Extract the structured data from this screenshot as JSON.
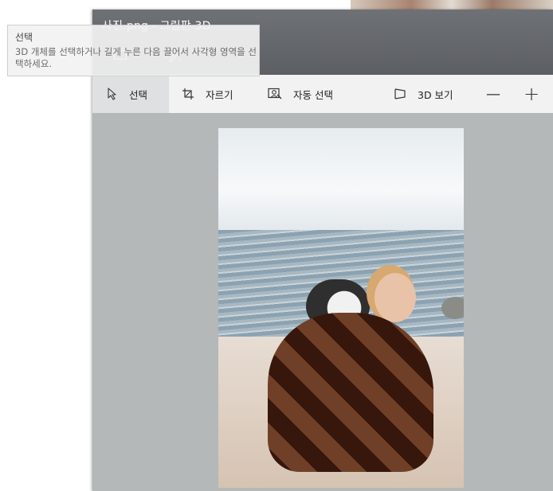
{
  "window": {
    "title": "사진.png - 그림판 3D"
  },
  "toolbar": {
    "select_label": "선택",
    "crop_label": "자르기",
    "magic_select_label": "자동 선택",
    "view3d_label": "3D 보기",
    "zoom_out_symbol": "—",
    "zoom_in_symbol": "+"
  },
  "tooltip": {
    "title": "선택",
    "body": "3D 개체를 선택하거나 길게 누른 다음 끌어서 사각형 영역을 선택하세요."
  },
  "icons": {
    "select": "cursor-arrow-icon",
    "crop": "crop-icon",
    "magic_select": "magic-select-icon",
    "view3d": "3d-view-icon",
    "zoom_out": "minus-icon",
    "zoom_in": "plus-icon",
    "title_tool_1": "canvas-icon",
    "title_tool_2": "brush-icon"
  },
  "colors": {
    "titlebar": "#5f6266",
    "toolbar": "#f2f2f2",
    "active_tool": "#dfe0e2",
    "canvas_bg": "#b5b8b8"
  }
}
